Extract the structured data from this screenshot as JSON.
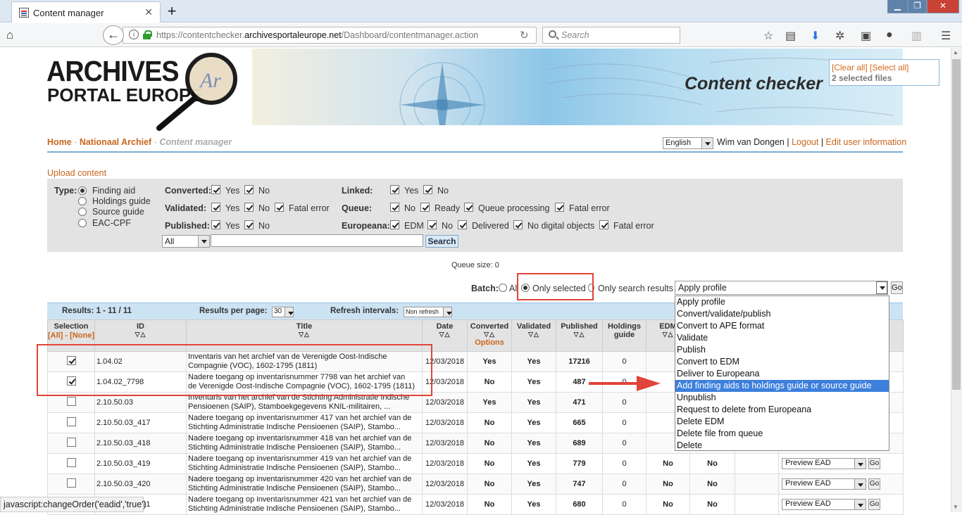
{
  "browser": {
    "tab_title": "Content manager",
    "new_tab": "+",
    "url_prefix": "https://contentchecker.",
    "url_domain": "archivesportaleurope.net",
    "url_path": "/Dashboard/contentmanager.action",
    "search_placeholder": "Search",
    "status_text": "javascript:changeOrder('eadid','true')"
  },
  "logo": {
    "line1": "ARCHIVES",
    "line2": "PORTAL EUROPE",
    "badge": "Ar"
  },
  "banner": {
    "title": "Content checker"
  },
  "selection_box": {
    "clear_all": "[Clear all]",
    "select_all": "[Select all]",
    "count": "2 selected files"
  },
  "breadcrumb": {
    "home": "Home",
    "sep": "-",
    "archive": "Nationaal Archief",
    "current": "Content manager"
  },
  "user": {
    "language": "English",
    "name": "Wim van Dongen",
    "logout": "Logout",
    "edit": "Edit user information",
    "sep": "|"
  },
  "upload_link": "Upload content",
  "filters": {
    "type_label": "Type:",
    "types": [
      "Finding aid",
      "Holdings guide",
      "Source guide",
      "EAC-CPF"
    ],
    "converted_label": "Converted:",
    "validated_label": "Validated:",
    "published_label": "Published:",
    "linked_label": "Linked:",
    "queue_label": "Queue:",
    "europeana_label": "Europeana:",
    "yes": "Yes",
    "no": "No",
    "fatal_error": "Fatal error",
    "ready": "Ready",
    "queue_processing": "Queue processing",
    "edm": "EDM",
    "delivered": "Delivered",
    "no_digital": "No digital objects",
    "search_scope": "All",
    "search_button": "Search"
  },
  "queue_size": "Queue size: 0",
  "batch": {
    "label": "Batch:",
    "all": "All",
    "only_selected": "Only selected",
    "only_search": "Only search results",
    "action_selected": "Apply profile",
    "go": "Go",
    "options": [
      "Apply profile",
      "Convert/validate/publish",
      "Convert to APE format",
      "Validate",
      "Publish",
      "Convert to EDM",
      "Deliver to Europeana",
      "Add finding aids to holdings guide or source guide",
      "Unpublish",
      "Request to delete from Europeana",
      "Delete EDM",
      "Delete file from queue",
      "Delete"
    ],
    "highlighted_index": 7
  },
  "results_bar": {
    "results": "Results: 1 - 11 / 11",
    "per_page_label": "Results per page:",
    "per_page": "30",
    "refresh_label": "Refresh intervals:",
    "refresh": "Non refresh"
  },
  "table": {
    "headers": {
      "selection": "Selection",
      "sel_links": "[All] - [None]",
      "id": "ID",
      "title": "Title",
      "date": "Date",
      "converted": "Converted",
      "options": "Options",
      "validated": "Validated",
      "published": "Published",
      "holdings": "Holdings guide",
      "edm": "EDM"
    },
    "preview": "Preview EAD",
    "go": "Go",
    "rows": [
      {
        "checked": true,
        "id": "1.04.02",
        "title1": "Inventaris van het archief van de Verenigde Oost-Indische",
        "title2": "Compagnie (VOC), 1602-1795 (1811)",
        "date": "12/03/2018",
        "converted": "Yes",
        "validated": "Yes",
        "published": "17216",
        "holdings": "0",
        "edm": "",
        "europeana": ""
      },
      {
        "checked": true,
        "id": "1.04.02_7798",
        "title1": "Nadere toegang op inventarisnummer 7798 van het archief van",
        "title2": "de Verenigde Oost-Indische Compagnie (VOC), 1602-1795 (1811)",
        "date": "12/03/2018",
        "converted": "No",
        "validated": "Yes",
        "published": "487",
        "holdings": "0",
        "edm": "",
        "europeana": ""
      },
      {
        "checked": false,
        "id": "2.10.50.03",
        "title1": "Inventaris van het archief van de Stichting Administratie Indische",
        "title2": "Pensioenen (SAIP), Stamboekgegevens KNIL-militairen, ...",
        "date": "12/03/2018",
        "converted": "Yes",
        "validated": "Yes",
        "published": "471",
        "holdings": "0",
        "edm": "",
        "europeana": ""
      },
      {
        "checked": false,
        "id": "2.10.50.03_417",
        "title1": "Nadere toegang op inventarisnummer 417 van het archief van de",
        "title2": "Stichting Administratie Indische Pensioenen (SAIP), Stambo...",
        "date": "12/03/2018",
        "converted": "No",
        "validated": "Yes",
        "published": "665",
        "holdings": "0",
        "edm": "",
        "europeana": ""
      },
      {
        "checked": false,
        "id": "2.10.50.03_418",
        "title1": "Nadere toegang op inventarisnummer 418 van het archief van de",
        "title2": "Stichting Administratie Indische Pensioenen (SAIP), Stambo...",
        "date": "12/03/2018",
        "converted": "No",
        "validated": "Yes",
        "published": "689",
        "holdings": "0",
        "edm": "",
        "europeana": ""
      },
      {
        "checked": false,
        "id": "2.10.50.03_419",
        "title1": "Nadere toegang op inventarisnummer 419 van het archief van de",
        "title2": "Stichting Administratie Indische Pensioenen (SAIP), Stambo...",
        "date": "12/03/2018",
        "converted": "No",
        "validated": "Yes",
        "published": "779",
        "holdings": "0",
        "edm": "No",
        "europeana": "No"
      },
      {
        "checked": false,
        "id": "2.10.50.03_420",
        "title1": "Nadere toegang op inventarisnummer 420 van het archief van de",
        "title2": "Stichting Administratie Indische Pensioenen (SAIP), Stambo...",
        "date": "12/03/2018",
        "converted": "No",
        "validated": "Yes",
        "published": "747",
        "holdings": "0",
        "edm": "No",
        "europeana": "No"
      },
      {
        "checked": false,
        "id": "2.10.50.03_421",
        "title1": "Nadere toegang op inventarisnummer 421 van het archief van de",
        "title2": "Stichting Administratie Indische Pensioenen (SAIP), Stambo...",
        "date": "12/03/2018",
        "converted": "No",
        "validated": "Yes",
        "published": "680",
        "holdings": "0",
        "edm": "No",
        "europeana": "No"
      }
    ]
  },
  "colors": {
    "accent": "#c9651c",
    "highlight_red": "#e0443a",
    "green": "#2e9a2e",
    "blue_select": "#3c7fdc"
  }
}
